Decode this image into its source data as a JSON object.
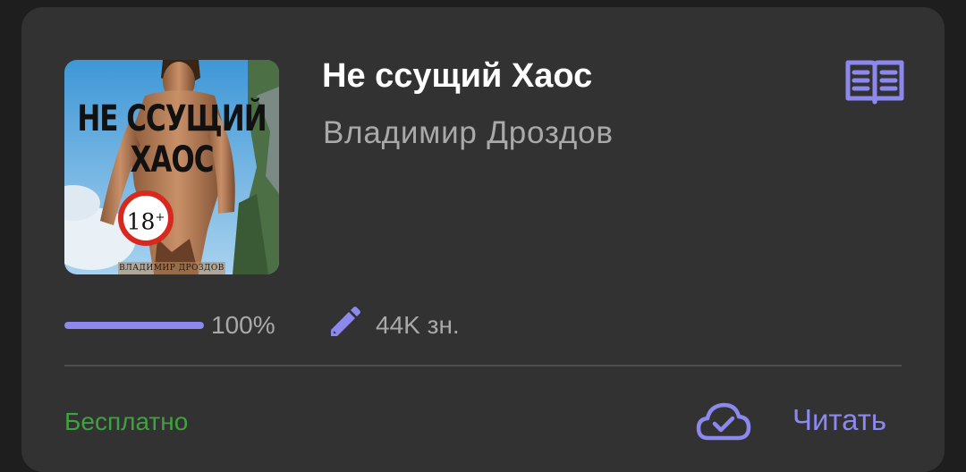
{
  "book": {
    "title": "Не ссущий Хаос",
    "author": "Владимир Дроздов",
    "cover": {
      "title_line1": "НЕ ССУЩИЙ",
      "title_line2": "ХАОС",
      "age_rating": "18",
      "age_plus": "+",
      "author_text": "ВЛАДИМИР ДРОЗДОВ"
    },
    "progress": {
      "value_percent": 100,
      "label": "100%"
    },
    "length_label": "44K зн.",
    "price_label": "Бесплатно",
    "read_button_label": "Читать"
  },
  "icons": {
    "read": "open-book-icon",
    "edit": "pencil-icon",
    "cloud": "cloud-check-icon"
  },
  "colors": {
    "card_background": "#323232",
    "accent": "#8c88ee",
    "free_label": "#3fa13f",
    "secondary_text": "#a9a9a9",
    "title_text": "#ffffff"
  }
}
